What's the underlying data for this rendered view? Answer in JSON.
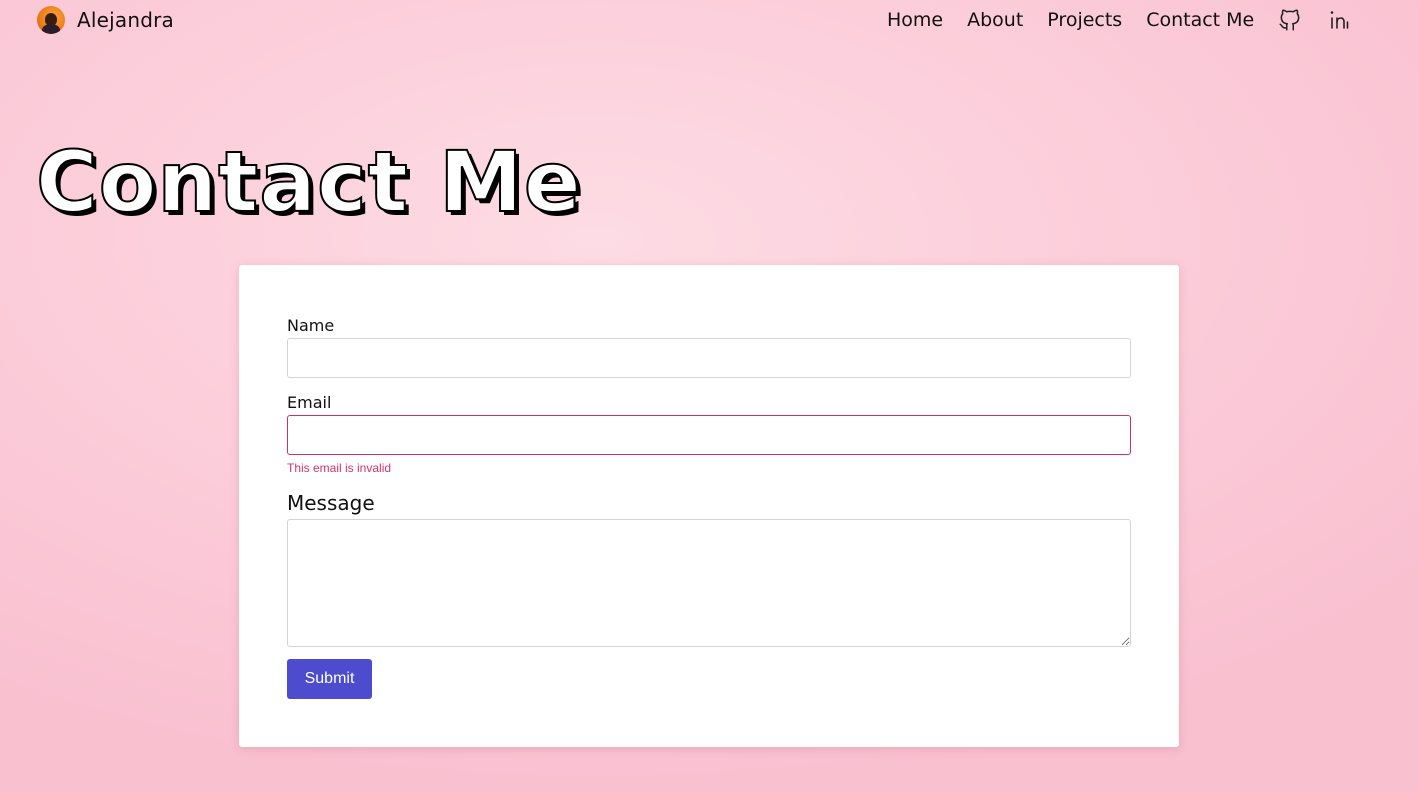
{
  "header": {
    "brand_name": "Alejandra",
    "avatar_icon": "profile-avatar",
    "nav": [
      {
        "label": "Home"
      },
      {
        "label": "About"
      },
      {
        "label": "Projects"
      },
      {
        "label": "Contact Me"
      }
    ],
    "social": [
      {
        "icon": "github-icon"
      },
      {
        "icon": "linkedin-icon"
      }
    ]
  },
  "page": {
    "title": "Contact Me"
  },
  "form": {
    "name_label": "Name",
    "name_value": "",
    "email_label": "Email",
    "email_value": "",
    "email_error": "This email is invalid",
    "message_label": "Message",
    "message_value": "",
    "submit_label": "Submit"
  },
  "colors": {
    "background": "#fcd0dc",
    "card": "#ffffff",
    "error": "#d6336c",
    "invalid_border": "#c9326b",
    "submit_button": "#4d4ccf"
  }
}
